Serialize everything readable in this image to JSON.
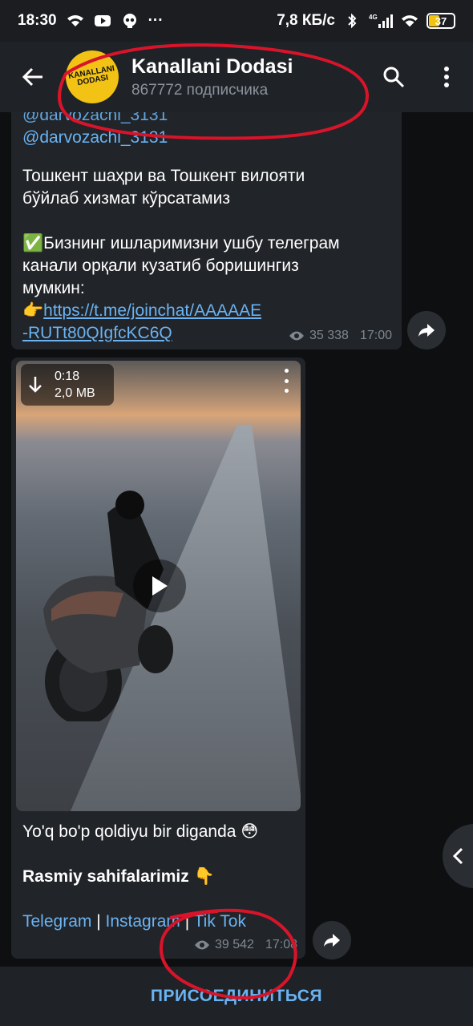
{
  "status_bar": {
    "time": "18:30",
    "left_icons": [
      "wifi-icon",
      "youtube-icon",
      "skull-icon"
    ],
    "more": "···",
    "net_speed": "7,8 КБ/с",
    "network_type": "4G",
    "battery": "37"
  },
  "header": {
    "title": "Kanallani Dodasi",
    "subtitle": "867772 подписчика",
    "avatar_text_top": "KANALLANI",
    "avatar_text_bottom": "DODASI"
  },
  "message1": {
    "partial_line": "@darvozachi_3131",
    "cut_line": "@darvozachi_3131",
    "line1": "Тошкент шаҳри ва Тошкент вилояти",
    "line2": "бўйлаб хизмат кўрсатамиз",
    "emoji_check": "✅",
    "para2_line1": "Бизнинг ишларимизни ушбу телеграм",
    "para2_line2": "канали орқали кузатиб боришингиз",
    "para2_line3": "мумкин:",
    "emoji_point": "👉",
    "link_line1": "https://t.me/joinchat/AAAAAE",
    "link_line2": "-RUTt80QIgfcKC6Q",
    "views": "35 338",
    "time": "17:00"
  },
  "message2": {
    "duration": "0:18",
    "size": "2,0 MB",
    "caption_line1": "Yo'q bo'p qoldiyu bir diganda",
    "emoji_flushed": "😳",
    "caption_line2": "Rasmiy sahifalarimiz",
    "emoji_down": "👇",
    "link_telegram": "Telegram",
    "link_instagram": "Instagram",
    "link_tiktok": "Tik Tok",
    "separator": " | ",
    "views": "39 542",
    "time": "17:08"
  },
  "bottom": {
    "join_label": "ПРИСОЕДИНИТЬСЯ"
  },
  "colors": {
    "accent": "#6ab3f3",
    "bubble": "#212428",
    "background": "#0e0f11",
    "annotation": "#d8142a"
  }
}
